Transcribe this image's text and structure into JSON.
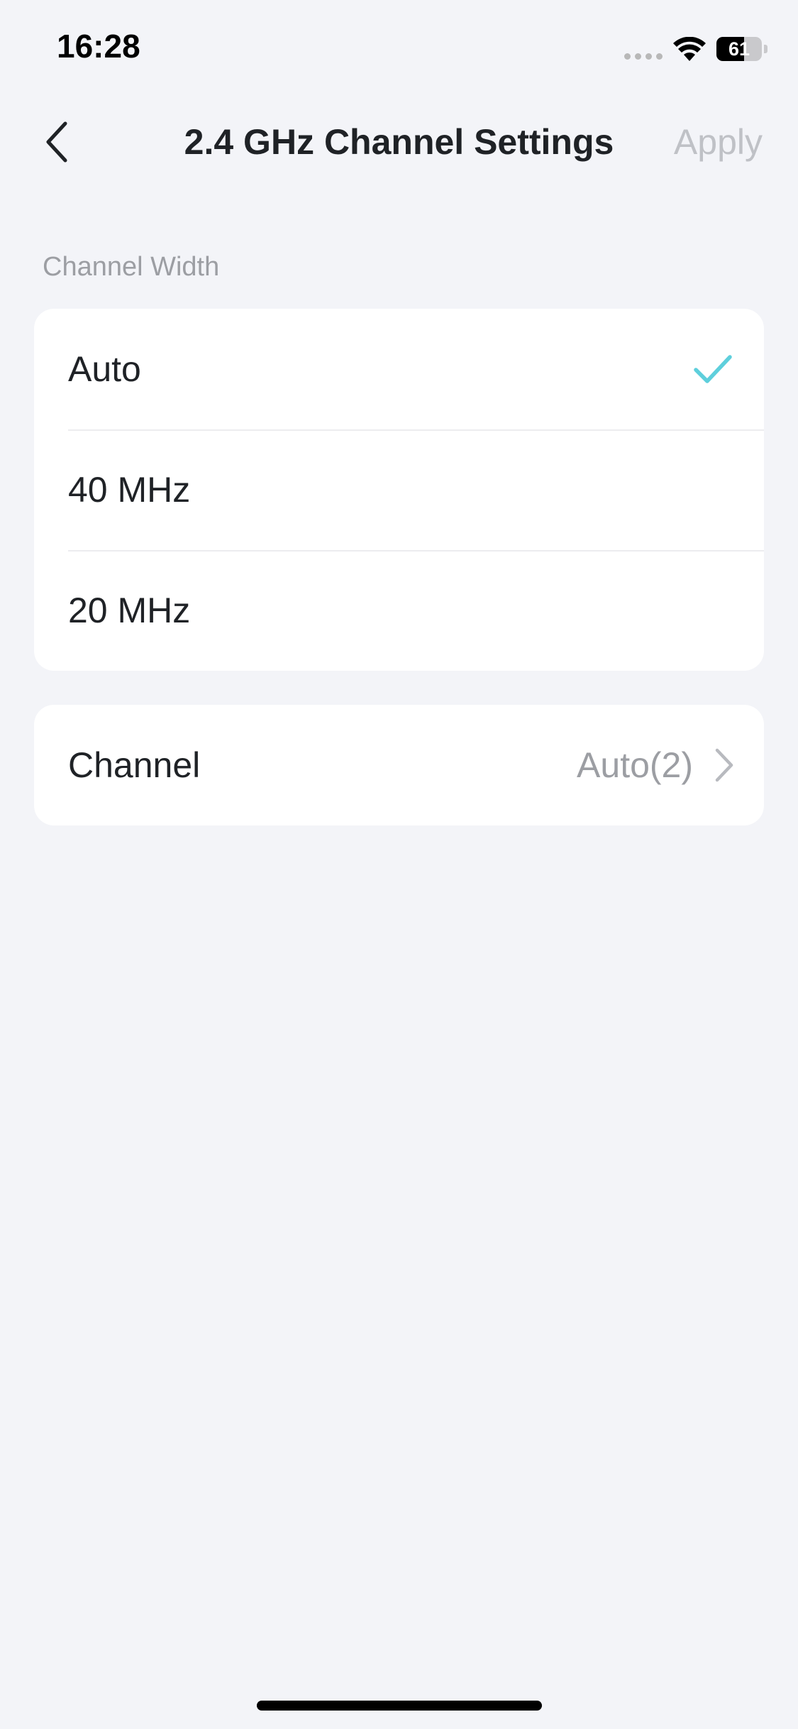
{
  "status_bar": {
    "time": "16:28",
    "battery_level": "61",
    "battery_percent": 61
  },
  "nav": {
    "title": "2.4 GHz Channel Settings",
    "apply_label": "Apply"
  },
  "channel_width": {
    "header": "Channel Width",
    "options": [
      {
        "label": "Auto",
        "selected": true
      },
      {
        "label": "40 MHz",
        "selected": false
      },
      {
        "label": "20 MHz",
        "selected": false
      }
    ]
  },
  "channel": {
    "label": "Channel",
    "value": "Auto(2)"
  },
  "colors": {
    "accent": "#5ecfdc",
    "background": "#f3f4f8",
    "muted_text": "#9c9ea3",
    "disabled_text": "#bfc1c6"
  },
  "icons": {
    "back": "chevron-left-icon",
    "check": "checkmark-icon",
    "chevron": "chevron-right-icon",
    "wifi": "wifi-icon",
    "battery": "battery-icon"
  }
}
